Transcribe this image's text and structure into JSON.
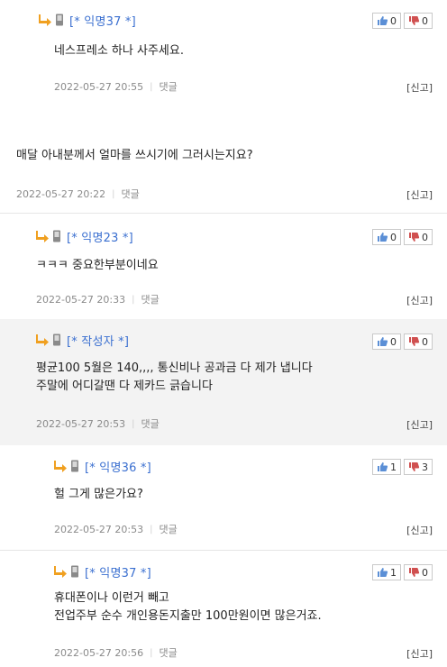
{
  "comments": [
    {
      "author": "[* 익명37 *]",
      "text": "네스프레소 하나 사주세요.",
      "date": "2022-05-27 20:55",
      "reply": "댓글",
      "report": "[신고]",
      "up": "0",
      "down": "0"
    },
    {
      "text": "매달 아내분께서 얼마를 쓰시기에 그러시는지요?",
      "date": "2022-05-27 20:22",
      "reply": "댓글",
      "report": "[신고]"
    },
    {
      "author": "[* 익명23 *]",
      "text": "ㅋㅋㅋ 중요한부분이네요",
      "date": "2022-05-27 20:33",
      "reply": "댓글",
      "report": "[신고]",
      "up": "0",
      "down": "0"
    },
    {
      "author": "[* 작성자 *]",
      "text": "평균100 5월은 140,,,, 통신비나 공과금 다 제가 냅니다\n주말에 어디갈땐 다 제카드 긁습니다",
      "date": "2022-05-27 20:53",
      "reply": "댓글",
      "report": "[신고]",
      "up": "0",
      "down": "0"
    },
    {
      "author": "[* 익명36 *]",
      "text": "헐 그게 많은가요?",
      "date": "2022-05-27 20:53",
      "reply": "댓글",
      "report": "[신고]",
      "up": "1",
      "down": "3"
    },
    {
      "author": "[* 익명37 *]",
      "text": "휴대폰이나 이런거 빼고\n전업주부 순수 개인용돈지출만 100만원이면 많은거죠.",
      "date": "2022-05-27 20:56",
      "reply": "댓글",
      "report": "[신고]",
      "up": "1",
      "down": "0"
    }
  ],
  "colors": {
    "author": "#3a6fd0",
    "reply_arrow": "#f0a020",
    "shaded_bg": "#f3f3f3"
  },
  "icons": {
    "reply": "reply-arrow-icon",
    "phone": "mobile-phone-icon",
    "up": "thumbs-up-icon",
    "down": "thumbs-down-icon"
  }
}
